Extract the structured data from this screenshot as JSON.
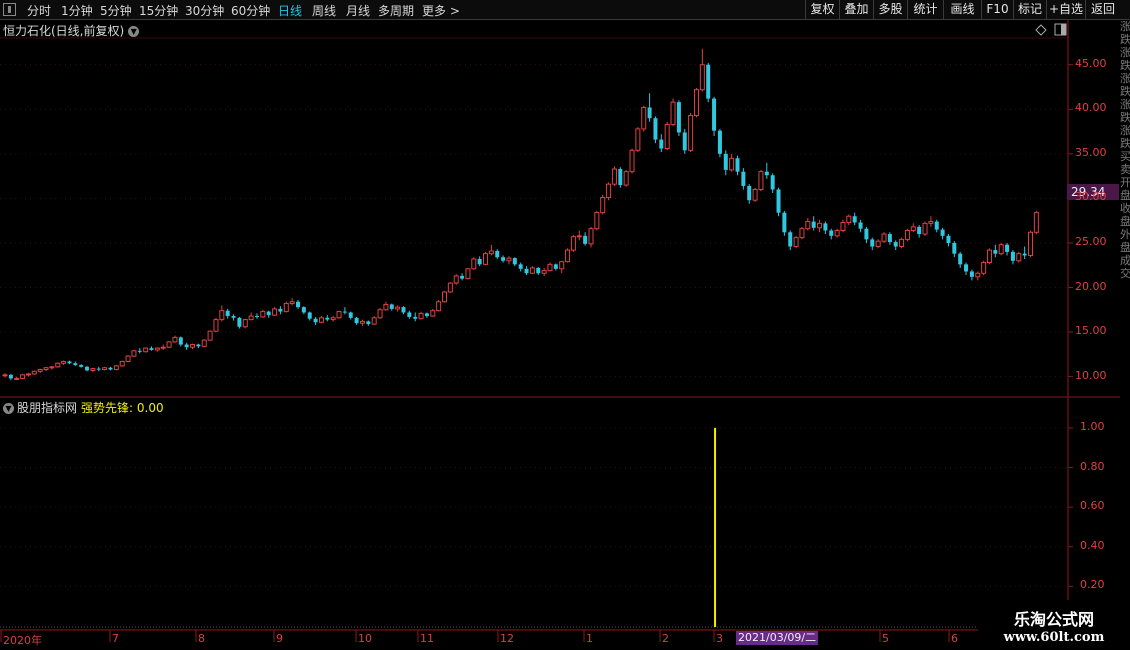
{
  "toolbar": {
    "periods": [
      {
        "label": "分时",
        "active": false
      },
      {
        "label": "1分钟",
        "active": false
      },
      {
        "label": "5分钟",
        "active": false
      },
      {
        "label": "15分钟",
        "active": false
      },
      {
        "label": "30分钟",
        "active": false
      },
      {
        "label": "60分钟",
        "active": false
      },
      {
        "label": "日线",
        "active": true
      },
      {
        "label": "周线",
        "active": false
      },
      {
        "label": "月线",
        "active": false
      },
      {
        "label": "多周期",
        "active": false
      },
      {
        "label": "更多 >",
        "active": false
      }
    ],
    "buttons": [
      "复权",
      "叠加",
      "多股",
      "统计",
      "画线",
      "F10",
      "标记",
      "+自选",
      "返回"
    ]
  },
  "main_chart": {
    "title": "恒力石化(日线,前复权)",
    "y_ticks": [
      "45.00",
      "40.00",
      "35.00",
      "30.00",
      "25.00",
      "20.00",
      "15.00",
      "10.00"
    ],
    "current_price": "29.34"
  },
  "indicator": {
    "source": "股朋指标网",
    "line_name": "强势先锋:",
    "value": "0.00",
    "y_ticks": [
      "1.00",
      "0.80",
      "0.60",
      "0.40",
      "0.20"
    ]
  },
  "x_axis": {
    "labels": [
      "2020年",
      "7",
      "8",
      "9",
      "10",
      "11",
      "12",
      "1",
      "2",
      "3",
      "5",
      "6"
    ],
    "cursor_date": "2021/03/09/二"
  },
  "side_column_text": "涨跌涨跌涨跌涨跌涨跌买卖开盘收盘外盘成交",
  "watermark": {
    "title": "乐淘公式网",
    "url": "www.60lt.com"
  },
  "colors": {
    "up": "#e04040",
    "down": "#30c8e0",
    "signal": "#f0f000",
    "axis": "#8a1a1a",
    "active_tab": "#22c4e6"
  },
  "chart_data": {
    "type": "candlestick",
    "title": "恒力石化(日线,前复权)",
    "ylim": [
      8.5,
      48
    ],
    "x_labels": [
      "2020年",
      "7",
      "8",
      "9",
      "10",
      "11",
      "12",
      "1",
      "2",
      "3",
      "5",
      "6"
    ],
    "ohlc": [
      [
        10.1,
        10.4,
        9.9,
        10.2
      ],
      [
        10.2,
        10.3,
        9.6,
        9.8
      ],
      [
        9.8,
        10.0,
        9.6,
        9.8
      ],
      [
        9.8,
        10.3,
        9.7,
        10.2
      ],
      [
        10.2,
        10.4,
        10.0,
        10.3
      ],
      [
        10.3,
        10.7,
        10.2,
        10.6
      ],
      [
        10.6,
        10.9,
        10.4,
        10.8
      ],
      [
        10.8,
        11.1,
        10.6,
        11.0
      ],
      [
        11.0,
        11.2,
        10.8,
        11.1
      ],
      [
        11.1,
        11.6,
        11.0,
        11.5
      ],
      [
        11.5,
        11.8,
        11.3,
        11.7
      ],
      [
        11.7,
        11.8,
        11.4,
        11.5
      ],
      [
        11.5,
        11.7,
        11.2,
        11.3
      ],
      [
        11.3,
        11.4,
        11.0,
        11.1
      ],
      [
        11.1,
        11.2,
        10.6,
        10.7
      ],
      [
        10.7,
        11.0,
        10.5,
        10.9
      ],
      [
        10.9,
        11.1,
        10.6,
        10.8
      ],
      [
        10.8,
        11.1,
        10.7,
        11.0
      ],
      [
        11.0,
        11.1,
        10.7,
        10.8
      ],
      [
        10.8,
        11.3,
        10.7,
        11.2
      ],
      [
        11.2,
        11.8,
        11.1,
        11.7
      ],
      [
        11.7,
        12.4,
        11.6,
        12.3
      ],
      [
        12.3,
        13.0,
        12.2,
        12.9
      ],
      [
        12.9,
        13.2,
        12.6,
        12.8
      ],
      [
        12.8,
        13.3,
        12.7,
        13.2
      ],
      [
        13.2,
        13.4,
        12.9,
        13.0
      ],
      [
        13.0,
        13.3,
        12.8,
        13.2
      ],
      [
        13.2,
        13.6,
        13.0,
        13.3
      ],
      [
        13.3,
        14.0,
        13.2,
        13.9
      ],
      [
        13.9,
        14.6,
        13.8,
        14.4
      ],
      [
        14.4,
        14.5,
        13.4,
        13.6
      ],
      [
        13.6,
        13.8,
        13.0,
        13.3
      ],
      [
        13.3,
        13.7,
        13.1,
        13.6
      ],
      [
        13.6,
        13.7,
        13.2,
        13.4
      ],
      [
        13.4,
        14.2,
        13.3,
        14.1
      ],
      [
        14.1,
        15.2,
        14.0,
        15.1
      ],
      [
        15.1,
        16.6,
        15.0,
        16.4
      ],
      [
        16.4,
        18.0,
        16.2,
        17.4
      ],
      [
        17.4,
        17.6,
        16.5,
        16.8
      ],
      [
        16.8,
        17.0,
        16.3,
        16.6
      ],
      [
        16.6,
        16.7,
        15.4,
        15.6
      ],
      [
        15.6,
        16.5,
        15.4,
        16.4
      ],
      [
        16.4,
        17.2,
        16.3,
        16.8
      ],
      [
        16.8,
        17.1,
        16.5,
        16.7
      ],
      [
        16.7,
        17.5,
        16.6,
        17.3
      ],
      [
        17.3,
        17.4,
        16.6,
        16.9
      ],
      [
        16.9,
        17.8,
        16.8,
        17.6
      ],
      [
        17.6,
        17.9,
        17.0,
        17.3
      ],
      [
        17.3,
        18.4,
        17.2,
        18.2
      ],
      [
        18.2,
        18.8,
        18.0,
        18.4
      ],
      [
        18.4,
        18.6,
        17.6,
        17.8
      ],
      [
        17.8,
        17.9,
        17.0,
        17.2
      ],
      [
        17.2,
        17.3,
        16.3,
        16.5
      ],
      [
        16.5,
        16.7,
        15.8,
        16.1
      ],
      [
        16.1,
        16.8,
        16.0,
        16.6
      ],
      [
        16.6,
        16.9,
        16.2,
        16.4
      ],
      [
        16.4,
        16.8,
        16.2,
        16.6
      ],
      [
        16.6,
        17.4,
        16.5,
        17.3
      ],
      [
        17.3,
        17.8,
        17.0,
        17.2
      ],
      [
        17.2,
        17.3,
        16.4,
        16.6
      ],
      [
        16.6,
        16.7,
        15.8,
        16.0
      ],
      [
        16.0,
        16.4,
        15.7,
        16.2
      ],
      [
        16.2,
        16.3,
        15.7,
        15.9
      ],
      [
        15.9,
        16.8,
        15.8,
        16.6
      ],
      [
        16.6,
        17.7,
        16.5,
        17.5
      ],
      [
        17.5,
        18.4,
        17.4,
        18.1
      ],
      [
        18.1,
        18.2,
        17.4,
        17.6
      ],
      [
        17.6,
        18.0,
        17.3,
        17.8
      ],
      [
        17.8,
        17.9,
        17.0,
        17.2
      ],
      [
        17.2,
        17.4,
        16.5,
        16.7
      ],
      [
        16.7,
        17.2,
        16.2,
        16.5
      ],
      [
        16.5,
        17.3,
        16.4,
        17.1
      ],
      [
        17.1,
        17.2,
        16.6,
        16.8
      ],
      [
        16.8,
        17.6,
        16.7,
        17.4
      ],
      [
        17.4,
        18.6,
        17.3,
        18.4
      ],
      [
        18.4,
        19.6,
        18.3,
        19.5
      ],
      [
        19.5,
        20.6,
        19.4,
        20.5
      ],
      [
        20.5,
        21.5,
        20.3,
        21.3
      ],
      [
        21.3,
        21.6,
        20.8,
        21.0
      ],
      [
        21.0,
        22.2,
        20.9,
        22.1
      ],
      [
        22.1,
        23.4,
        22.0,
        23.2
      ],
      [
        23.2,
        23.5,
        22.4,
        22.6
      ],
      [
        22.6,
        24.0,
        22.5,
        23.8
      ],
      [
        23.8,
        24.8,
        23.6,
        24.1
      ],
      [
        24.1,
        24.3,
        23.2,
        23.4
      ],
      [
        23.4,
        23.6,
        22.8,
        23.0
      ],
      [
        23.0,
        23.5,
        22.6,
        23.3
      ],
      [
        23.3,
        23.4,
        22.4,
        22.6
      ],
      [
        22.6,
        22.8,
        21.8,
        22.1
      ],
      [
        22.1,
        22.4,
        21.4,
        21.6
      ],
      [
        21.6,
        22.4,
        21.5,
        22.2
      ],
      [
        22.2,
        22.3,
        21.4,
        21.6
      ],
      [
        21.6,
        22.2,
        21.3,
        21.9
      ],
      [
        21.9,
        22.8,
        21.8,
        22.6
      ],
      [
        22.6,
        22.7,
        21.9,
        22.1
      ],
      [
        22.1,
        23.0,
        21.6,
        22.9
      ],
      [
        22.9,
        24.4,
        22.8,
        24.2
      ],
      [
        24.2,
        25.9,
        24.0,
        25.7
      ],
      [
        25.7,
        26.4,
        25.3,
        25.8
      ],
      [
        25.8,
        26.2,
        24.7,
        24.9
      ],
      [
        24.9,
        26.8,
        24.5,
        26.6
      ],
      [
        26.6,
        28.6,
        26.4,
        28.4
      ],
      [
        28.4,
        30.4,
        28.2,
        30.1
      ],
      [
        30.1,
        31.8,
        29.8,
        31.6
      ],
      [
        31.6,
        33.6,
        31.4,
        33.3
      ],
      [
        33.3,
        33.5,
        31.2,
        31.5
      ],
      [
        31.5,
        33.2,
        31.3,
        33.0
      ],
      [
        33.0,
        35.6,
        32.8,
        35.4
      ],
      [
        35.4,
        38.0,
        35.2,
        37.8
      ],
      [
        37.8,
        40.4,
        37.5,
        40.2
      ],
      [
        40.2,
        41.8,
        38.6,
        39.0
      ],
      [
        39.0,
        39.2,
        36.2,
        36.6
      ],
      [
        36.6,
        37.2,
        35.2,
        35.6
      ],
      [
        35.6,
        38.6,
        35.4,
        38.3
      ],
      [
        38.3,
        41.2,
        38.1,
        40.8
      ],
      [
        40.8,
        41.0,
        37.0,
        37.4
      ],
      [
        37.4,
        37.8,
        35.0,
        35.4
      ],
      [
        35.4,
        39.6,
        35.2,
        39.3
      ],
      [
        39.3,
        42.4,
        39.1,
        42.2
      ],
      [
        42.2,
        46.8,
        42.0,
        45.0
      ],
      [
        45.0,
        45.2,
        40.8,
        41.2
      ],
      [
        41.2,
        41.4,
        37.0,
        37.6
      ],
      [
        37.6,
        37.8,
        34.6,
        35.0
      ],
      [
        35.0,
        35.4,
        32.6,
        33.2
      ],
      [
        33.2,
        35.0,
        33.0,
        34.5
      ],
      [
        34.5,
        34.8,
        32.6,
        33.0
      ],
      [
        33.0,
        33.4,
        31.0,
        31.4
      ],
      [
        31.4,
        31.6,
        29.4,
        29.8
      ],
      [
        29.8,
        31.2,
        29.6,
        31.0
      ],
      [
        31.0,
        33.2,
        30.8,
        33.0
      ],
      [
        33.0,
        34.0,
        32.2,
        32.6
      ],
      [
        32.6,
        32.8,
        30.6,
        31.0
      ],
      [
        31.0,
        31.2,
        28.0,
        28.4
      ],
      [
        28.4,
        28.6,
        25.8,
        26.2
      ],
      [
        26.2,
        26.4,
        24.2,
        24.6
      ],
      [
        24.6,
        25.8,
        24.4,
        25.6
      ],
      [
        25.6,
        26.8,
        25.4,
        26.6
      ],
      [
        26.6,
        27.8,
        26.4,
        27.4
      ],
      [
        27.4,
        28.0,
        26.4,
        26.7
      ],
      [
        26.7,
        27.6,
        26.2,
        27.2
      ],
      [
        27.2,
        27.4,
        26.0,
        26.4
      ],
      [
        26.4,
        26.6,
        25.4,
        25.8
      ],
      [
        25.8,
        26.6,
        25.6,
        26.4
      ],
      [
        26.4,
        27.6,
        26.2,
        27.3
      ],
      [
        27.3,
        28.2,
        27.0,
        28.0
      ],
      [
        28.0,
        28.4,
        27.0,
        27.3
      ],
      [
        27.3,
        27.6,
        26.2,
        26.6
      ],
      [
        26.6,
        26.8,
        25.0,
        25.4
      ],
      [
        25.4,
        25.6,
        24.2,
        24.6
      ],
      [
        24.6,
        25.4,
        24.4,
        25.2
      ],
      [
        25.2,
        26.2,
        25.0,
        26.0
      ],
      [
        26.0,
        26.2,
        24.8,
        25.1
      ],
      [
        25.1,
        25.3,
        24.2,
        24.6
      ],
      [
        24.6,
        25.6,
        24.4,
        25.4
      ],
      [
        25.4,
        26.6,
        25.2,
        26.4
      ],
      [
        26.4,
        27.2,
        26.2,
        26.8
      ],
      [
        26.8,
        27.0,
        25.6,
        26.0
      ],
      [
        26.0,
        27.4,
        25.8,
        27.2
      ],
      [
        27.2,
        28.0,
        26.8,
        27.4
      ],
      [
        27.4,
        27.6,
        26.2,
        26.5
      ],
      [
        26.5,
        26.7,
        25.4,
        25.8
      ],
      [
        25.8,
        26.0,
        24.6,
        25.0
      ],
      [
        25.0,
        25.2,
        23.4,
        23.8
      ],
      [
        23.8,
        24.0,
        22.2,
        22.6
      ],
      [
        22.6,
        22.8,
        21.4,
        21.8
      ],
      [
        21.8,
        22.0,
        20.8,
        21.2
      ],
      [
        21.2,
        21.8,
        20.8,
        21.6
      ],
      [
        21.6,
        23.0,
        21.4,
        22.8
      ],
      [
        22.8,
        24.4,
        22.6,
        24.2
      ],
      [
        24.2,
        24.8,
        23.4,
        23.8
      ],
      [
        23.8,
        25.0,
        23.6,
        24.8
      ],
      [
        24.8,
        25.0,
        23.6,
        24.0
      ],
      [
        24.0,
        24.2,
        22.6,
        23.0
      ],
      [
        23.0,
        24.0,
        22.8,
        23.8
      ],
      [
        23.8,
        24.6,
        23.2,
        23.6
      ],
      [
        23.6,
        26.4,
        23.4,
        26.2
      ],
      [
        26.2,
        28.6,
        26.0,
        28.4
      ]
    ],
    "indicator": {
      "name": "强势先锋",
      "ylim": [
        0,
        1.05
      ],
      "signal_bar_index": 121,
      "signal_value": 1.0
    }
  }
}
